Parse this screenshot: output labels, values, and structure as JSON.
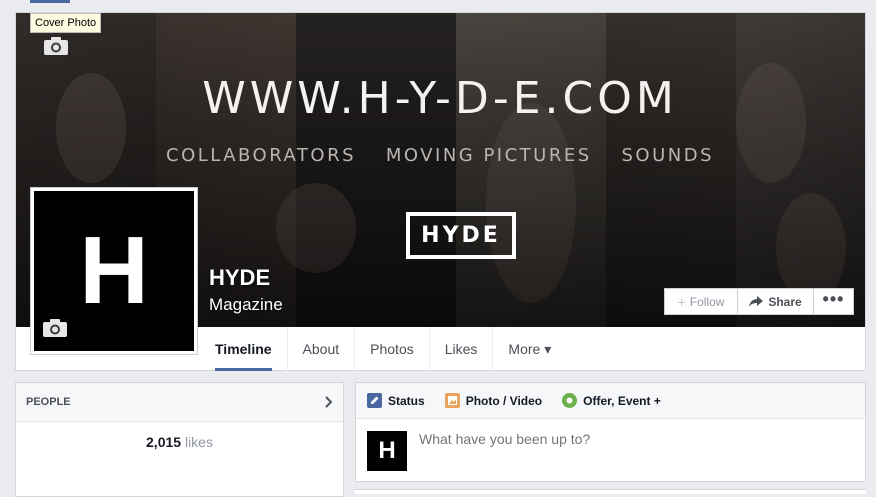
{
  "tooltip": "Cover Photo",
  "cover": {
    "site_url": "WWW.H-Y-D-E.COM",
    "links": [
      "COLLABORATORS",
      "MOVING PICTURES",
      "SOUNDS"
    ],
    "logo_text": "HYDE"
  },
  "profile": {
    "initial": "H",
    "name": "HYDE",
    "category": "Magazine"
  },
  "actions": {
    "follow": "Follow",
    "share": "Share",
    "more": "•••"
  },
  "tabs": [
    "Timeline",
    "About",
    "Photos",
    "Likes",
    "More ▾"
  ],
  "people": {
    "title": "PEOPLE",
    "likes_count": "2,015",
    "likes_label": "likes"
  },
  "composer": {
    "tabs": [
      "Status",
      "Photo / Video",
      "Offer, Event +"
    ],
    "placeholder": "What have you been up to?",
    "avatar_initial": "H"
  },
  "colors": {
    "accent": "#4b67a1",
    "background": "#e9ebee"
  }
}
